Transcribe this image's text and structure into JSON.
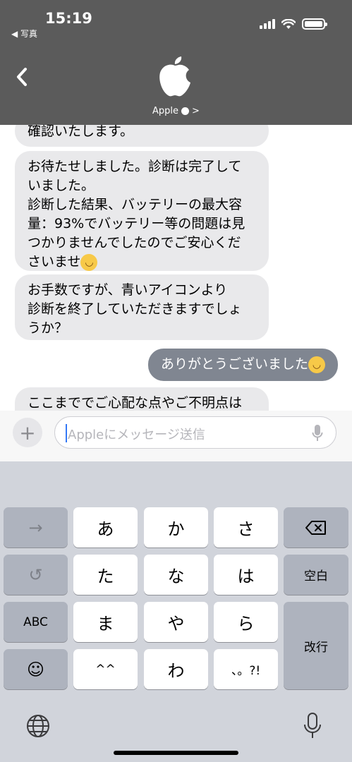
{
  "status_bar": {
    "time": "15:19",
    "back_app": "◀ 写真"
  },
  "nav": {
    "contact_name": "Apple",
    "chevron": ">"
  },
  "messages": [
    {
      "side": "incoming",
      "lines": [
        "確認いたします。"
      ]
    },
    {
      "side": "incoming",
      "lines": [
        "お待たせしました。診断は完了して",
        "いました。",
        "診断した結果、バッテリーの最大容",
        "量：93%でバッテリー等の問題は見",
        "つかりませんでしたのでご安心くだ",
        "さいませ"
      ]
    },
    {
      "side": "incoming",
      "lines": [
        "お手数ですが、青いアイコンより",
        "診断を終了していただきますでしょ",
        "うか？"
      ]
    },
    {
      "side": "outgoing",
      "lines": [
        "ありがとうございました"
      ]
    },
    {
      "side": "incoming",
      "lines": [
        "ここまででご心配な点やご不明点は"
      ]
    }
  ],
  "input": {
    "plus_label": "+",
    "placeholder": "Appleにメッセージ送信"
  },
  "keyboard": {
    "arrow": "→",
    "backspace": "⌫",
    "undo": "↺",
    "space": "空白",
    "abc": "ABC",
    "enter": "改行",
    "emoji": "☺",
    "row1": [
      "あ",
      "か",
      "さ"
    ],
    "row2": [
      "た",
      "な",
      "は"
    ],
    "row3": [
      "ま",
      "や",
      "ら"
    ],
    "row4": [
      "^^",
      "わ",
      "、。?!"
    ]
  },
  "colors": {
    "header_bg": "#5b5b5b",
    "incoming_bubble": "#e9e9eb",
    "outgoing_bubble": "#808691",
    "keyboard_bg": "#d1d4db",
    "cursor": "#3478f6"
  }
}
